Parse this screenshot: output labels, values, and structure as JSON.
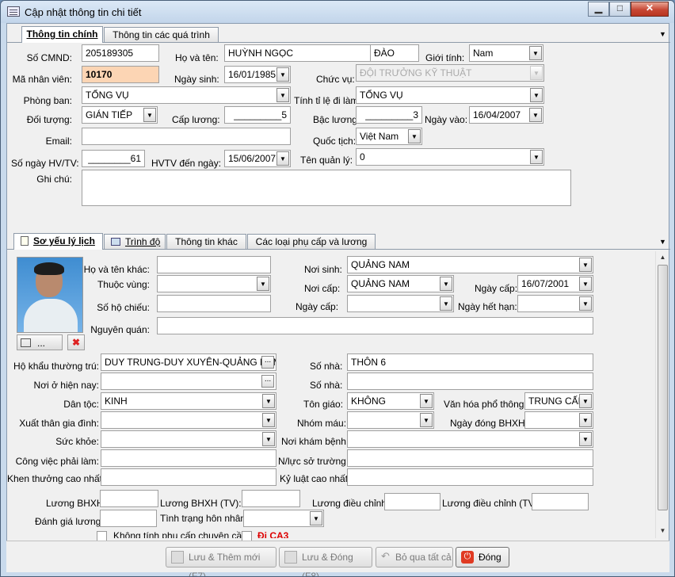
{
  "window": {
    "title": "Cập nhật thông tin chi tiết",
    "min": "▁",
    "max": "□",
    "close": "✕"
  },
  "top_tabs": [
    "Thông tin chính",
    "Thông tin các quá trình"
  ],
  "main": {
    "so_cmnd_label": "Số CMND:",
    "so_cmnd": "205189305",
    "ho_ten_label": "Họ và tên:",
    "ho": "HUỲNH NGỌC",
    "ten": "ĐÀO",
    "gioi_tinh_label": "Giới tính:",
    "gioi_tinh": "Nam",
    "ma_nv_label": "Mã nhân viên:",
    "ma_nv": "10170",
    "ngay_sinh_label": "Ngày sinh:",
    "ngay_sinh": "16/01/1985",
    "chuc_vu_label": "Chức vụ:",
    "chuc_vu": "ĐỘI TRƯỞNG KỸ THUẬT",
    "phong_ban_label": "Phòng ban:",
    "phong_ban": "TỔNG VỤ",
    "tinh_ti_le_label": "Tính tỉ lệ đi làm:",
    "tinh_ti_le": "TỔNG VỤ",
    "doi_tuong_label": "Đối tượng:",
    "doi_tuong": "GIÁN TIẾP",
    "cap_luong_label": "Cấp lương:",
    "cap_luong": "_________5",
    "bac_luong_label": "Bậc lương:",
    "bac_luong": "_________3",
    "ngay_vao_label": "Ngày vào:",
    "ngay_vao": "16/04/2007",
    "email_label": "Email:",
    "email": "",
    "quoc_tich_label": "Quốc tịch:",
    "quoc_tich": "Việt Nam",
    "so_ngay_label": "Số ngày HV/TV:",
    "so_ngay": "________61",
    "hvtv_label": "HVTV đến ngày:",
    "hvtv": "15/06/2007",
    "ten_quan_ly_label": "Tên quản lý:",
    "ten_quan_ly": "0",
    "ghi_chu_label": "Ghi chú:",
    "ghi_chu": ""
  },
  "sub_tabs": [
    "Sơ yếu lý lịch",
    "Trình độ",
    "Thông tin khác",
    "Các loại phụ cấp và lương"
  ],
  "profile": {
    "ho_ten_khac_label": "Họ và tên khác:",
    "ho_ten_khac": "",
    "noi_sinh_label": "Nơi sinh:",
    "noi_sinh": "QUẢNG NAM",
    "thuoc_vung_label": "Thuộc vùng:",
    "thuoc_vung": "",
    "noi_cap_label": "Nơi cấp:",
    "noi_cap": "QUẢNG NAM",
    "ngay_cap_label": "Ngày cấp:",
    "ngay_cap": "16/07/2001",
    "so_ho_chieu_label": "Số hộ chiếu:",
    "so_ho_chieu": "",
    "ngay_cap2_label": "Ngày cấp:",
    "ngay_cap2": "",
    "ngay_het_han_label": "Ngày hết hạn:",
    "ngay_het_han": "",
    "nguyen_quan_label": "Nguyên quán:",
    "nguyen_quan": "",
    "photo_browse": "...",
    "ho_khau_label": "Hộ khẩu thường trú:",
    "ho_khau": "DUY TRUNG-DUY XUYÊN-QUẢNG NAM",
    "so_nha_label": "Số nhà:",
    "so_nha": "THÔN 6",
    "noi_o_label": "Nơi ở hiện nay:",
    "noi_o": "",
    "so_nha2_label": "Số nhà:",
    "so_nha2": "",
    "dan_toc_label": "Dân tộc:",
    "dan_toc": "KINH",
    "ton_giao_label": "Tôn giáo:",
    "ton_giao": "KHÔNG",
    "van_hoa_label": "Văn hóa phổ thông:",
    "van_hoa": "TRUNG CẤP",
    "xuat_than_label": "Xuất thân gia đình:",
    "xuat_than": "",
    "nhom_mau_label": "Nhóm máu:",
    "nhom_mau": "",
    "ngay_dong_label": "Ngày đóng BHXH:",
    "ngay_dong": "",
    "suc_khoe_label": "Sức khỏe:",
    "suc_khoe": "",
    "noi_kham_label": "Nơi khám bệnh:",
    "noi_kham": "",
    "cong_viec_label": "Công việc phải làm:",
    "cong_viec": "",
    "nang_luc_label": "N/lực sở trường:",
    "nang_luc": "",
    "khen_thuong_label": "Khen thưởng cao nhất:",
    "khen_thuong": "",
    "ky_luat_label": "Kỷ luật cao nhất:",
    "ky_luat": "",
    "luong_bhxh_label": "Lương BHXH:",
    "luong_bhxh": "",
    "luong_bhxh_tv_label": "Lương BHXH (TV):",
    "luong_bhxh_tv": "",
    "luong_dc_label": "Lương điều chỉnh:",
    "luong_dc": "",
    "luong_dc_tv_label": "Lương điều chỉnh (TV):",
    "luong_dc_tv": "",
    "danh_gia_label": "Đánh giá lương:",
    "danh_gia": "",
    "hon_nhan_label": "Tình trạng hôn nhân:",
    "hon_nhan": "",
    "khong_tinh_label": "Không tính phụ cấp chuyên cần",
    "di_ca3_label": "Đi CA3"
  },
  "footer": {
    "save_add": "Lưu  & Thêm mới (F7)",
    "save_close": "Lưu  & Đóng (F8)",
    "skip_all": "Bỏ qua tất cả",
    "close": "Đóng"
  }
}
